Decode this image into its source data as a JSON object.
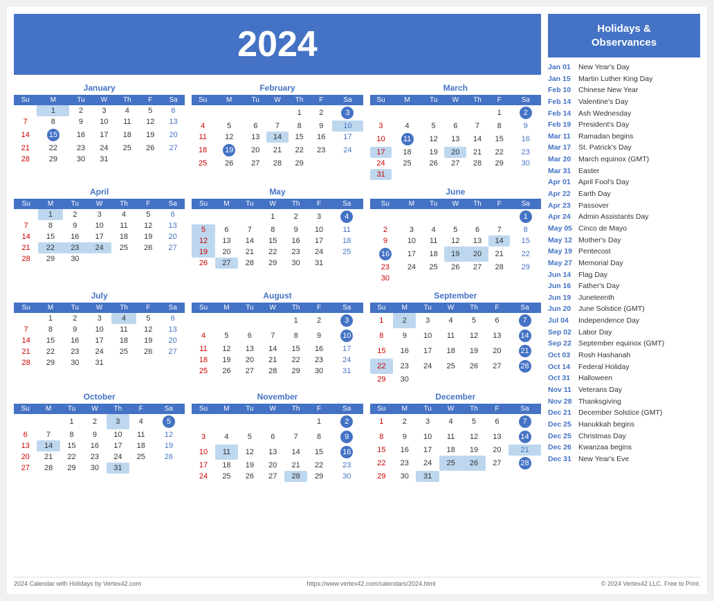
{
  "year": "2024",
  "footer": {
    "left": "2024 Calendar with Holidays by Vertex42.com",
    "center": "https://www.vertex42.com/calendars/2024.html",
    "right": "© 2024 Vertex42 LLC. Free to Print."
  },
  "sidebar": {
    "title": "Holidays &\nObservances",
    "holidays": [
      {
        "date": "Jan 01",
        "name": "New Year's Day"
      },
      {
        "date": "Jan 15",
        "name": "Martin Luther King Day"
      },
      {
        "date": "Feb 10",
        "name": "Chinese New Year"
      },
      {
        "date": "Feb 14",
        "name": "Valentine's Day"
      },
      {
        "date": "Feb 14",
        "name": "Ash Wednesday"
      },
      {
        "date": "Feb 19",
        "name": "President's Day"
      },
      {
        "date": "Mar 11",
        "name": "Ramadan begins"
      },
      {
        "date": "Mar 17",
        "name": "St. Patrick's Day"
      },
      {
        "date": "Mar 20",
        "name": "March equinox (GMT)"
      },
      {
        "date": "Mar 31",
        "name": "Easter"
      },
      {
        "date": "Apr 01",
        "name": "April Fool's Day"
      },
      {
        "date": "Apr 22",
        "name": "Earth Day"
      },
      {
        "date": "Apr 23",
        "name": "Passover"
      },
      {
        "date": "Apr 24",
        "name": "Admin Assistants Day"
      },
      {
        "date": "May 05",
        "name": "Cinco de Mayo"
      },
      {
        "date": "May 12",
        "name": "Mother's Day"
      },
      {
        "date": "May 19",
        "name": "Pentecost"
      },
      {
        "date": "May 27",
        "name": "Memorial Day"
      },
      {
        "date": "Jun 14",
        "name": "Flag Day"
      },
      {
        "date": "Jun 16",
        "name": "Father's Day"
      },
      {
        "date": "Jun 19",
        "name": "Juneteenth"
      },
      {
        "date": "Jun 20",
        "name": "June Solstice (GMT)"
      },
      {
        "date": "Jul 04",
        "name": "Independence Day"
      },
      {
        "date": "Sep 02",
        "name": "Labor Day"
      },
      {
        "date": "Sep 22",
        "name": "September equinox (GMT)"
      },
      {
        "date": "Oct 03",
        "name": "Rosh Hashanah"
      },
      {
        "date": "Oct 14",
        "name": "Federal Holiday"
      },
      {
        "date": "Oct 31",
        "name": "Halloween"
      },
      {
        "date": "Nov 11",
        "name": "Veterans Day"
      },
      {
        "date": "Nov 28",
        "name": "Thanksgiving"
      },
      {
        "date": "Dec 21",
        "name": "December Solstice (GMT)"
      },
      {
        "date": "Dec 25",
        "name": "Hanukkah begins"
      },
      {
        "date": "Dec 25",
        "name": "Christmas Day"
      },
      {
        "date": "Dec 26",
        "name": "Kwanzaa begins"
      },
      {
        "date": "Dec 31",
        "name": "New Year's Eve"
      }
    ]
  },
  "months": [
    {
      "name": "January",
      "weeks": [
        [
          "",
          "1",
          "2",
          "3",
          "4",
          "5",
          "6"
        ],
        [
          "7",
          "8",
          "9",
          "10",
          "11",
          "12",
          "13"
        ],
        [
          "14",
          "15",
          "16",
          "17",
          "18",
          "19",
          "20"
        ],
        [
          "21",
          "22",
          "23",
          "24",
          "25",
          "26",
          "27"
        ],
        [
          "28",
          "29",
          "30",
          "31",
          "",
          "",
          ""
        ]
      ],
      "highlights": [
        "1"
      ],
      "holidays": [
        "1",
        "15"
      ]
    },
    {
      "name": "February",
      "weeks": [
        [
          "",
          "",
          "",
          "",
          "1",
          "2",
          "3"
        ],
        [
          "4",
          "5",
          "6",
          "7",
          "8",
          "9",
          "10"
        ],
        [
          "11",
          "12",
          "13",
          "14",
          "15",
          "16",
          "17"
        ],
        [
          "18",
          "19",
          "20",
          "21",
          "22",
          "23",
          "24"
        ],
        [
          "25",
          "26",
          "27",
          "28",
          "29",
          "",
          ""
        ]
      ],
      "highlights": [
        "10",
        "14"
      ],
      "holidays": [
        "3",
        "10",
        "14",
        "19"
      ]
    },
    {
      "name": "March",
      "weeks": [
        [
          "",
          "",
          "",
          "",
          "",
          "1",
          "2"
        ],
        [
          "3",
          "4",
          "5",
          "6",
          "7",
          "8",
          "9"
        ],
        [
          "10",
          "11",
          "12",
          "13",
          "14",
          "15",
          "16"
        ],
        [
          "17",
          "18",
          "19",
          "20",
          "21",
          "22",
          "23"
        ],
        [
          "24",
          "25",
          "26",
          "27",
          "28",
          "29",
          "30"
        ],
        [
          "31",
          "",
          "",
          "",
          "",
          "",
          ""
        ]
      ],
      "highlights": [
        "17",
        "20",
        "31"
      ],
      "holidays": [
        "2",
        "11",
        "17",
        "20",
        "31"
      ]
    },
    {
      "name": "April",
      "weeks": [
        [
          "",
          "1",
          "2",
          "3",
          "4",
          "5",
          "6"
        ],
        [
          "7",
          "8",
          "9",
          "10",
          "11",
          "12",
          "13"
        ],
        [
          "14",
          "15",
          "16",
          "17",
          "18",
          "19",
          "20"
        ],
        [
          "21",
          "22",
          "23",
          "24",
          "25",
          "26",
          "27"
        ],
        [
          "28",
          "29",
          "30",
          "",
          "",
          "",
          ""
        ]
      ],
      "highlights": [
        "1",
        "22",
        "23",
        "24"
      ],
      "holidays": [
        "1",
        "22",
        "23",
        "24"
      ]
    },
    {
      "name": "May",
      "weeks": [
        [
          "",
          "",
          "",
          "1",
          "2",
          "3",
          "4"
        ],
        [
          "5",
          "6",
          "7",
          "8",
          "9",
          "10",
          "11"
        ],
        [
          "12",
          "13",
          "14",
          "15",
          "16",
          "17",
          "18"
        ],
        [
          "19",
          "20",
          "21",
          "22",
          "23",
          "24",
          "25"
        ],
        [
          "26",
          "27",
          "28",
          "29",
          "30",
          "31",
          ""
        ]
      ],
      "highlights": [
        "5",
        "12",
        "19",
        "27"
      ],
      "holidays": [
        "4",
        "5",
        "12",
        "19",
        "27"
      ]
    },
    {
      "name": "June",
      "weeks": [
        [
          "",
          "",
          "",
          "",
          "",
          "",
          "1"
        ],
        [
          "2",
          "3",
          "4",
          "5",
          "6",
          "7",
          "8"
        ],
        [
          "9",
          "10",
          "11",
          "12",
          "13",
          "14",
          "15"
        ],
        [
          "16",
          "17",
          "18",
          "19",
          "20",
          "21",
          "22"
        ],
        [
          "23",
          "24",
          "25",
          "26",
          "27",
          "28",
          "29"
        ],
        [
          "30",
          "",
          "",
          "",
          "",
          "",
          ""
        ]
      ],
      "highlights": [
        "14",
        "19",
        "20"
      ],
      "holidays": [
        "1",
        "14",
        "16",
        "19",
        "20"
      ]
    },
    {
      "name": "July",
      "weeks": [
        [
          "",
          "1",
          "2",
          "3",
          "4",
          "5",
          "6"
        ],
        [
          "7",
          "8",
          "9",
          "10",
          "11",
          "12",
          "13"
        ],
        [
          "14",
          "15",
          "16",
          "17",
          "18",
          "19",
          "20"
        ],
        [
          "21",
          "22",
          "23",
          "24",
          "25",
          "26",
          "27"
        ],
        [
          "28",
          "29",
          "30",
          "31",
          "",
          "",
          ""
        ]
      ],
      "highlights": [
        "4"
      ],
      "holidays": [
        "4"
      ]
    },
    {
      "name": "August",
      "weeks": [
        [
          "",
          "",
          "",
          "",
          "1",
          "2",
          "3"
        ],
        [
          "4",
          "5",
          "6",
          "7",
          "8",
          "9",
          "10"
        ],
        [
          "11",
          "12",
          "13",
          "14",
          "15",
          "16",
          "17"
        ],
        [
          "18",
          "19",
          "20",
          "21",
          "22",
          "23",
          "24"
        ],
        [
          "25",
          "26",
          "27",
          "28",
          "29",
          "30",
          "31"
        ]
      ],
      "highlights": [],
      "holidays": [
        "3",
        "10"
      ]
    },
    {
      "name": "September",
      "weeks": [
        [
          "1",
          "2",
          "3",
          "4",
          "5",
          "6",
          "7"
        ],
        [
          "8",
          "9",
          "10",
          "11",
          "12",
          "13",
          "14"
        ],
        [
          "15",
          "16",
          "17",
          "18",
          "19",
          "20",
          "21"
        ],
        [
          "22",
          "23",
          "24",
          "25",
          "26",
          "27",
          "28"
        ],
        [
          "29",
          "30",
          "",
          "",
          "",
          "",
          ""
        ]
      ],
      "highlights": [
        "2",
        "22"
      ],
      "holidays": [
        "2",
        "7",
        "14",
        "21",
        "22",
        "28"
      ]
    },
    {
      "name": "October",
      "weeks": [
        [
          "",
          "",
          "1",
          "2",
          "3",
          "4",
          "5"
        ],
        [
          "6",
          "7",
          "8",
          "9",
          "10",
          "11",
          "12"
        ],
        [
          "13",
          "14",
          "15",
          "16",
          "17",
          "18",
          "19"
        ],
        [
          "20",
          "21",
          "22",
          "23",
          "24",
          "25",
          "26"
        ],
        [
          "27",
          "28",
          "29",
          "30",
          "31",
          "",
          ""
        ]
      ],
      "highlights": [
        "3",
        "14",
        "31"
      ],
      "holidays": [
        "3",
        "5",
        "14",
        "31"
      ]
    },
    {
      "name": "November",
      "weeks": [
        [
          "",
          "",
          "",
          "",
          "",
          "1",
          "2"
        ],
        [
          "3",
          "4",
          "5",
          "6",
          "7",
          "8",
          "9"
        ],
        [
          "10",
          "11",
          "12",
          "13",
          "14",
          "15",
          "16"
        ],
        [
          "17",
          "18",
          "19",
          "20",
          "21",
          "22",
          "23"
        ],
        [
          "24",
          "25",
          "26",
          "27",
          "28",
          "29",
          "30"
        ]
      ],
      "highlights": [
        "11",
        "28"
      ],
      "holidays": [
        "2",
        "9",
        "11",
        "16",
        "28"
      ]
    },
    {
      "name": "December",
      "weeks": [
        [
          "1",
          "2",
          "3",
          "4",
          "5",
          "6",
          "7"
        ],
        [
          "8",
          "9",
          "10",
          "11",
          "12",
          "13",
          "14"
        ],
        [
          "15",
          "16",
          "17",
          "18",
          "19",
          "20",
          "21"
        ],
        [
          "22",
          "23",
          "24",
          "25",
          "26",
          "27",
          "28"
        ],
        [
          "29",
          "30",
          "31",
          "",
          "",
          "",
          ""
        ]
      ],
      "highlights": [
        "21",
        "25",
        "26",
        "31"
      ],
      "holidays": [
        "7",
        "14",
        "21",
        "25",
        "26",
        "28",
        "31"
      ]
    }
  ]
}
